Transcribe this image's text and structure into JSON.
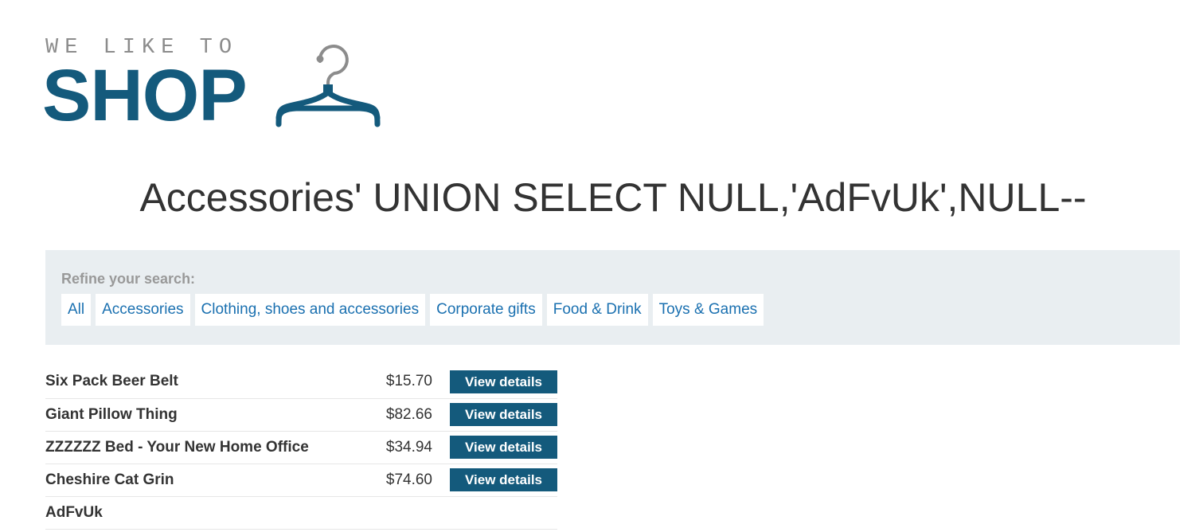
{
  "logo": {
    "tagline": "WE LIKE TO",
    "word": "SHOP",
    "icon": "hanger-icon",
    "brand_color": "#145a7c",
    "tagline_color": "#8c8c8c"
  },
  "page_title": "Accessories' UNION SELECT NULL,'AdFvUk',NULL--",
  "filters": {
    "label": "Refine your search:",
    "items": [
      {
        "label": "All"
      },
      {
        "label": "Accessories"
      },
      {
        "label": "Clothing, shoes and accessories"
      },
      {
        "label": "Corporate gifts"
      },
      {
        "label": "Food & Drink"
      },
      {
        "label": "Toys & Games"
      }
    ],
    "link_color": "#1a70b0",
    "panel_color": "#e9eef1"
  },
  "products": [
    {
      "name": "Six Pack Beer Belt",
      "price": "$15.70",
      "action": "View details"
    },
    {
      "name": "Giant Pillow Thing",
      "price": "$82.66",
      "action": "View details"
    },
    {
      "name": "ZZZZZZ Bed - Your New Home Office",
      "price": "$34.94",
      "action": "View details"
    },
    {
      "name": "Cheshire Cat Grin",
      "price": "$74.60",
      "action": "View details"
    },
    {
      "name": "AdFvUk",
      "price": "",
      "action": ""
    }
  ]
}
